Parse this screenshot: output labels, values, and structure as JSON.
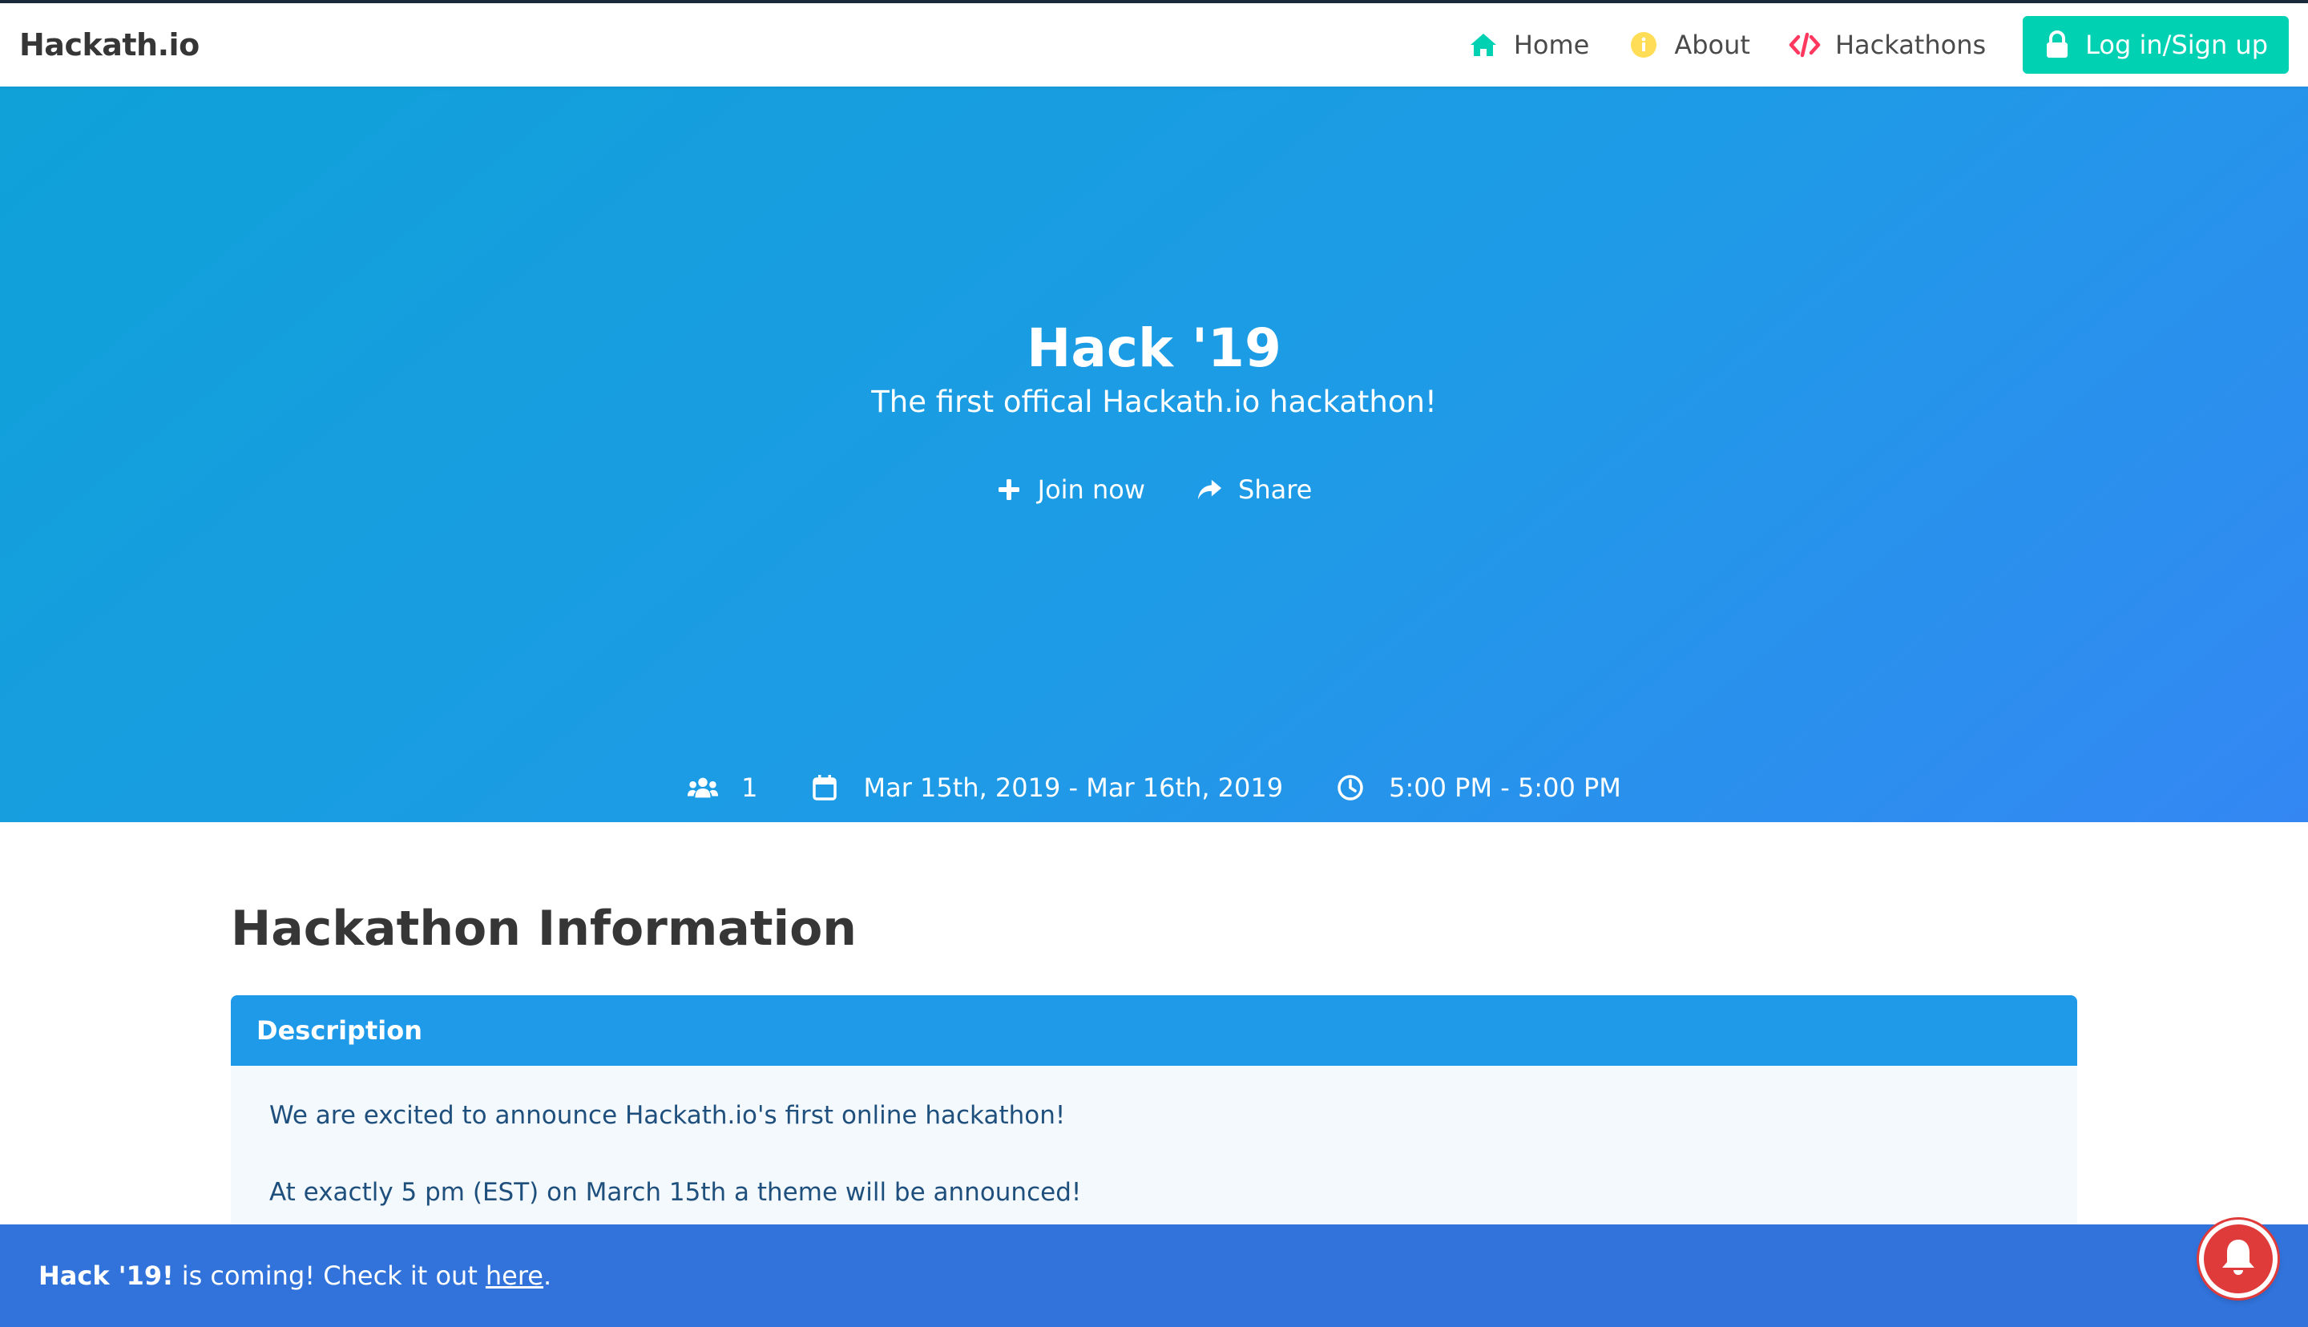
{
  "navbar": {
    "brand": "Hackath.io",
    "items": [
      {
        "label": "Home",
        "icon": "home-icon"
      },
      {
        "label": "About",
        "icon": "info-icon"
      },
      {
        "label": "Hackathons",
        "icon": "code-icon"
      }
    ],
    "login_label": "Log in/Sign up"
  },
  "hero": {
    "title": "Hack '19",
    "subtitle": "The first offical Hackath.io hackathon!",
    "actions": {
      "join_label": "Join now",
      "share_label": "Share"
    },
    "stats": {
      "participants": "1",
      "dates": "Mar 15th, 2019 - Mar 16th, 2019",
      "times": "5:00 PM - 5:00 PM"
    }
  },
  "main": {
    "section_title": "Hackathon Information",
    "card": {
      "header": "Description",
      "paragraphs": [
        "We are excited to announce Hackath.io's first online hackathon!",
        "At exactly 5 pm (EST) on March 15th a theme will be announced!"
      ]
    }
  },
  "notice": {
    "bold": "Hack '19!",
    "text": "is coming! Check it out",
    "link": "here",
    "suffix": "."
  },
  "colors": {
    "accent": "#00d1b2",
    "hero_start": "#0fa1d8",
    "hero_end": "#3487f3",
    "card_header": "#1f9ae9",
    "notice": "#3173db",
    "bell": "#e03b3b",
    "about_icon": "#ffdd57",
    "hackathons_icon": "#ff3860"
  }
}
